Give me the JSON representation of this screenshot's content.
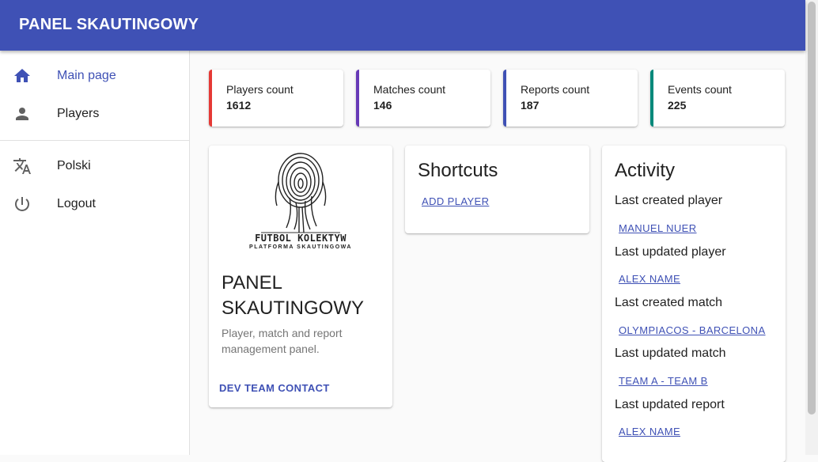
{
  "app": {
    "title": "PANEL SKAUTINGOWY"
  },
  "sidebar": {
    "items": [
      {
        "label": "Main page",
        "icon": "home-icon",
        "active": true
      },
      {
        "label": "Players",
        "icon": "person-icon"
      },
      {
        "label": "Polski",
        "icon": "translate-icon"
      },
      {
        "label": "Logout",
        "icon": "power-icon"
      }
    ]
  },
  "stats": [
    {
      "label": "Players count",
      "value": "1612",
      "color": "#e53935"
    },
    {
      "label": "Matches count",
      "value": "146",
      "color": "#673ab7"
    },
    {
      "label": "Reports count",
      "value": "187",
      "color": "#3f51b5"
    },
    {
      "label": "Events count",
      "value": "225",
      "color": "#00897b"
    }
  ],
  "panel_card": {
    "logo_text": "FUTBOL KOLEKTYW",
    "logo_subtext": "PLATFORMA SKAUTINGOWA",
    "title": "PANEL SKAUTINGOWY",
    "description": "Player, match and report management panel.",
    "contact_label": "DEV TEAM CONTACT"
  },
  "shortcuts": {
    "title": "Shortcuts",
    "add_player_label": "ADD PLAYER"
  },
  "activity": {
    "title": "Activity",
    "items": [
      {
        "label": "Last created player",
        "link": "MANUEL NUER"
      },
      {
        "label": "Last updated player",
        "link": "ALEX NAME"
      },
      {
        "label": "Last created match",
        "link": "OLYMPIACOS - BARCELONA"
      },
      {
        "label": "Last updated match",
        "link": "TEAM A - TEAM B"
      },
      {
        "label": "Last updated report",
        "link": "ALEX NAME"
      }
    ]
  },
  "colors": {
    "primary": "#3f51b5"
  }
}
